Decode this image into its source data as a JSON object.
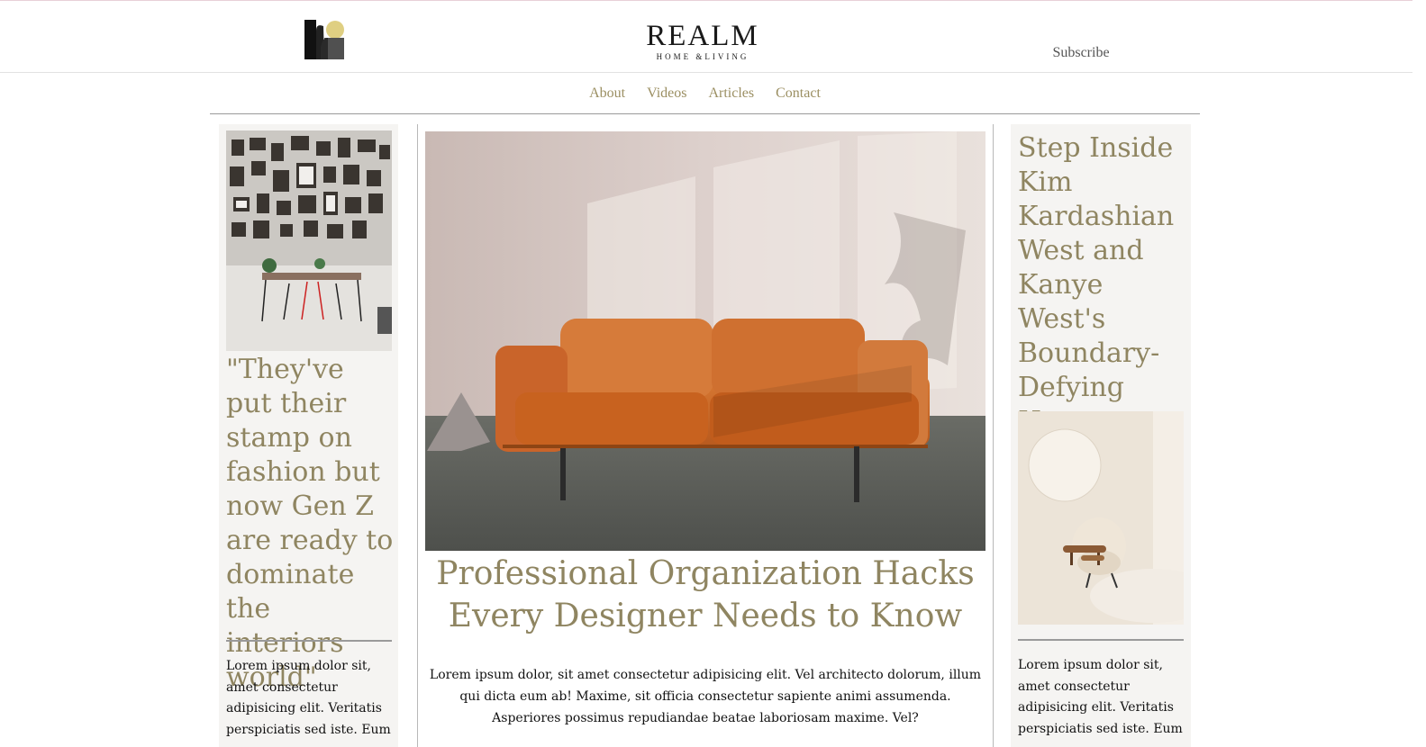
{
  "brand": {
    "name": "REALM",
    "tagline": "HOME &LIVING"
  },
  "header": {
    "subscribe_label": "Subscribe"
  },
  "nav": {
    "items": [
      "About",
      "Videos",
      "Articles",
      "Contact"
    ]
  },
  "left_column": {
    "headline": "\"They've put their stamp on fashion but now Gen Z are ready to dominate the interiors world\"",
    "excerpt": "Lorem ipsum dolor sit, amet consectetur adipisicing elit. Veritatis perspiciatis sed iste. Eum"
  },
  "main_article": {
    "title": "Professional Organization Hacks Every Designer Needs to Know",
    "body": "Lorem ipsum dolor, sit amet consectetur adipisicing elit. Vel architecto dolorum, illum qui dicta eum ab! Maxime, sit officia consectetur sapiente animi assumenda. Asperiores possimus repudiandae beatae laboriosam maxime. Vel?"
  },
  "right_column": {
    "headline": "Step Inside Kim Kardashian West and Kanye West's Boundary-Defying Home",
    "excerpt": "Lorem ipsum dolor sit, amet consectetur adipisicing elit. Veritatis perspiciatis sed iste. Eum"
  },
  "colors": {
    "accent": "#8f8561",
    "nav": "#9b8f62",
    "panel": "#f5f4f2",
    "logo_gold": "#dfcf82"
  }
}
